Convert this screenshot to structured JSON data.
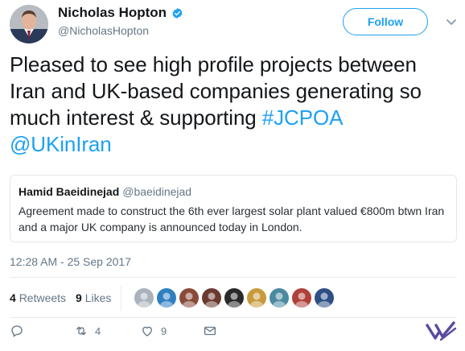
{
  "author": {
    "name": "Nicholas Hopton",
    "handle": "@NicholasHopton",
    "verified": true
  },
  "follow_label": "Follow",
  "tweet": {
    "text": "Pleased to see high profile projects between Iran and UK-based companies generating so much interest & supporting ",
    "hashtag": "#JCPOA",
    "mention": "@UKinIran"
  },
  "quoted_tweet": {
    "name": "Hamid Baeidinejad",
    "handle": "@baeidinejad",
    "text": "Agreement made to construct the 6th ever largest solar plant valued €800m btwn Iran and a major UK company is announced today in London."
  },
  "timestamp": "12:28 AM - 25 Sep 2017",
  "stats": {
    "retweets_count": "4",
    "retweets_label": "Retweets",
    "likes_count": "9",
    "likes_label": "Likes"
  },
  "actions": {
    "reply_count": "",
    "retweet_count": "4",
    "like_count": "9"
  },
  "likers": [
    {
      "color": "#aab2bb"
    },
    {
      "color": "#2f7fc1"
    },
    {
      "color": "#8a4a3a"
    },
    {
      "color": "#6b3a2e"
    },
    {
      "color": "#2a2a2a"
    },
    {
      "color": "#c89a3c"
    },
    {
      "color": "#4a8aa0"
    },
    {
      "color": "#b0403a"
    },
    {
      "color": "#2d4f86"
    }
  ],
  "icons": {
    "verified": "verified-badge-icon",
    "caret": "chevron-down-icon",
    "reply": "reply-icon",
    "retweet": "retweet-icon",
    "like": "heart-icon",
    "message": "envelope-icon",
    "brand": "brand-logo-icon"
  },
  "colors": {
    "accent": "#1da1f2",
    "muted": "#657786",
    "border": "#e1e8ed",
    "brand": "#5b4aa0"
  }
}
